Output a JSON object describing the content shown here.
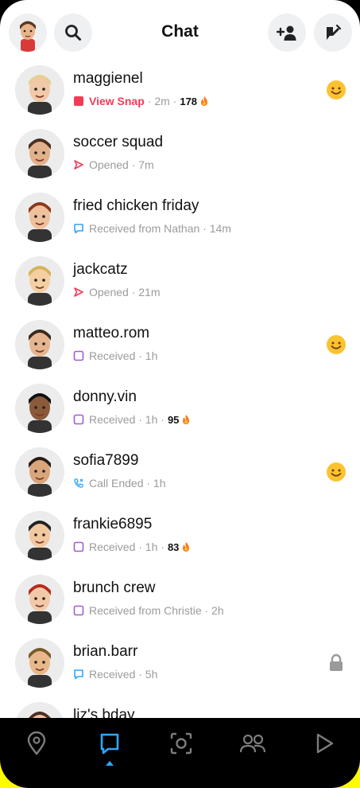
{
  "header": {
    "title": "Chat"
  },
  "colors": {
    "brand_yellow": "#FFFC00",
    "snap_red": "#F23C57",
    "chat_blue": "#2FA6FF",
    "received_purple": "#A05DCD",
    "opened_red": "#F23C57"
  },
  "chats": [
    {
      "name": "maggienel",
      "status_icon": "red-snap-square-icon",
      "status_label": "View Snap",
      "status_time": "· 2m ·",
      "streak": "178",
      "right_icon": "smiley-emoji-icon"
    },
    {
      "name": "soccer squad",
      "status_icon": "opened-arrow-icon",
      "status_label": "Opened · 7m",
      "status_time": "",
      "streak": "",
      "right_icon": ""
    },
    {
      "name": "fried chicken friday",
      "status_icon": "chat-bubble-icon",
      "status_label": "Received from Nathan · 14m",
      "status_time": "",
      "streak": "",
      "right_icon": ""
    },
    {
      "name": "jackcatz",
      "status_icon": "opened-arrow-icon",
      "status_label": "Opened · 21m",
      "status_time": "",
      "streak": "",
      "right_icon": ""
    },
    {
      "name": "matteo.rom",
      "status_icon": "received-square-icon",
      "status_label": "Received · 1h",
      "status_time": "",
      "streak": "",
      "right_icon": "smiley-emoji-icon"
    },
    {
      "name": "donny.vin",
      "status_icon": "received-square-icon",
      "status_label": "Received · 1h ·",
      "status_time": "",
      "streak": "95",
      "right_icon": ""
    },
    {
      "name": "sofia7899",
      "status_icon": "call-ended-icon",
      "status_label": "Call Ended · 1h",
      "status_time": "",
      "streak": "",
      "right_icon": "smiley-emoji-icon"
    },
    {
      "name": "frankie6895",
      "status_icon": "received-square-icon",
      "status_label": "Received · 1h ·",
      "status_time": "",
      "streak": "83",
      "right_icon": ""
    },
    {
      "name": "brunch crew",
      "status_icon": "received-square-icon",
      "status_label": "Received from Christie · 2h",
      "status_time": "",
      "streak": "",
      "right_icon": ""
    },
    {
      "name": "brian.barr",
      "status_icon": "chat-bubble-icon",
      "status_label": "Received · 5h",
      "status_time": "",
      "streak": "",
      "right_icon": "lock-icon"
    },
    {
      "name": "liz's bday",
      "status_icon": "",
      "status_label": "",
      "status_time": "",
      "streak": "",
      "right_icon": ""
    }
  ],
  "nav": {
    "items": [
      "map-icon",
      "chat-icon",
      "camera-icon",
      "friends-icon",
      "spotlight-icon"
    ],
    "active": "chat-icon"
  }
}
